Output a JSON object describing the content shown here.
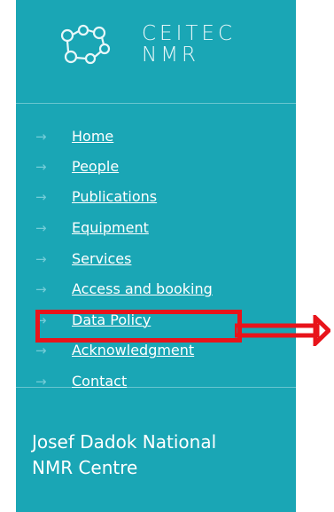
{
  "brand": {
    "logo_text_line1": "CEITEC",
    "logo_text_line2": "NMR",
    "accent_color": "#1aa6b5",
    "logo_icon": "molecule-icon"
  },
  "menu": {
    "items": [
      {
        "label": "Home",
        "icon": "arrow-right-icon"
      },
      {
        "label": "People",
        "icon": "arrow-right-icon"
      },
      {
        "label": "Publications",
        "icon": "arrow-right-icon"
      },
      {
        "label": "Equipment",
        "icon": "arrow-right-icon"
      },
      {
        "label": "Services",
        "icon": "arrow-right-icon"
      },
      {
        "label": "Access and booking",
        "icon": "arrow-right-icon"
      },
      {
        "label": "Data Policy",
        "icon": "arrow-right-icon"
      },
      {
        "label": "Acknowledgment",
        "icon": "arrow-right-icon"
      },
      {
        "label": "Contact",
        "icon": "arrow-right-icon"
      }
    ]
  },
  "footer": {
    "title": "Josef Dadok National\nNMR Centre"
  },
  "annotation": {
    "highlight_color": "#e8141b"
  }
}
